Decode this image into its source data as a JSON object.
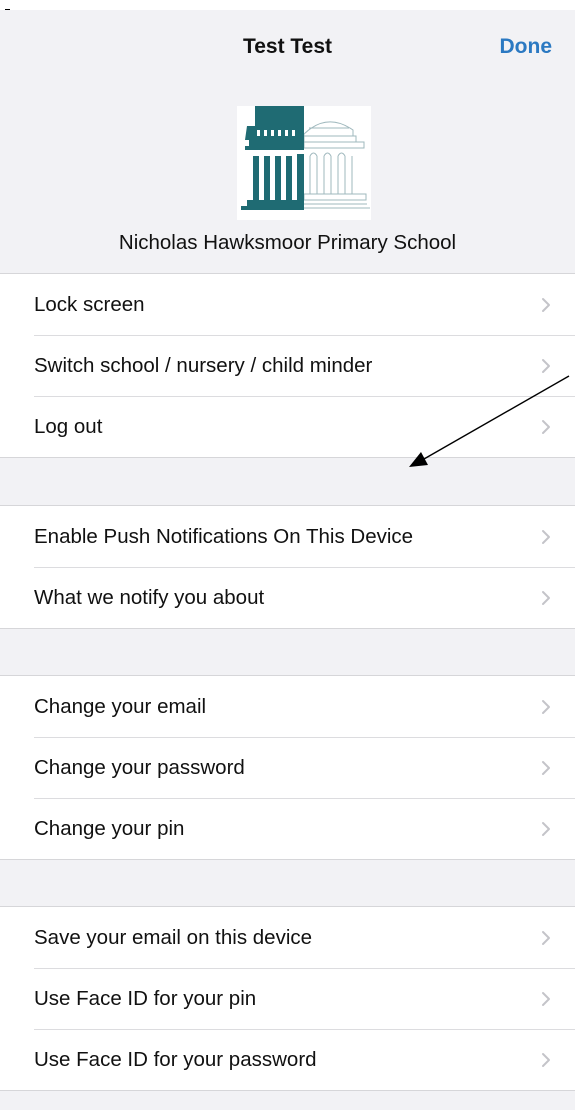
{
  "nav": {
    "title": "Test Test",
    "done_label": "Done"
  },
  "school": {
    "name": "Nicholas Hawksmoor Primary School",
    "logo_icon": "school-building-logo"
  },
  "colors": {
    "accent": "#2b79c2",
    "logo_teal": "#1f6b73",
    "group_background": "#f2f2f5",
    "separator": "#dcdcdf",
    "chevron": "#c4c4c9"
  },
  "groups": [
    {
      "items": [
        {
          "label": "Lock screen"
        },
        {
          "label": "Switch school / nursery / child minder"
        },
        {
          "label": "Log out"
        }
      ]
    },
    {
      "items": [
        {
          "label": "Enable Push Notifications On This Device"
        },
        {
          "label": "What we notify you about"
        }
      ]
    },
    {
      "items": [
        {
          "label": "Change your email"
        },
        {
          "label": "Change your password"
        },
        {
          "label": "Change your pin"
        }
      ]
    },
    {
      "items": [
        {
          "label": "Save your email on this device"
        },
        {
          "label": "Use Face ID for your pin"
        },
        {
          "label": "Use Face ID for your password"
        }
      ]
    }
  ],
  "row_icon": "chevron-right-icon",
  "annotation": {
    "icon": "annotation-arrow"
  }
}
